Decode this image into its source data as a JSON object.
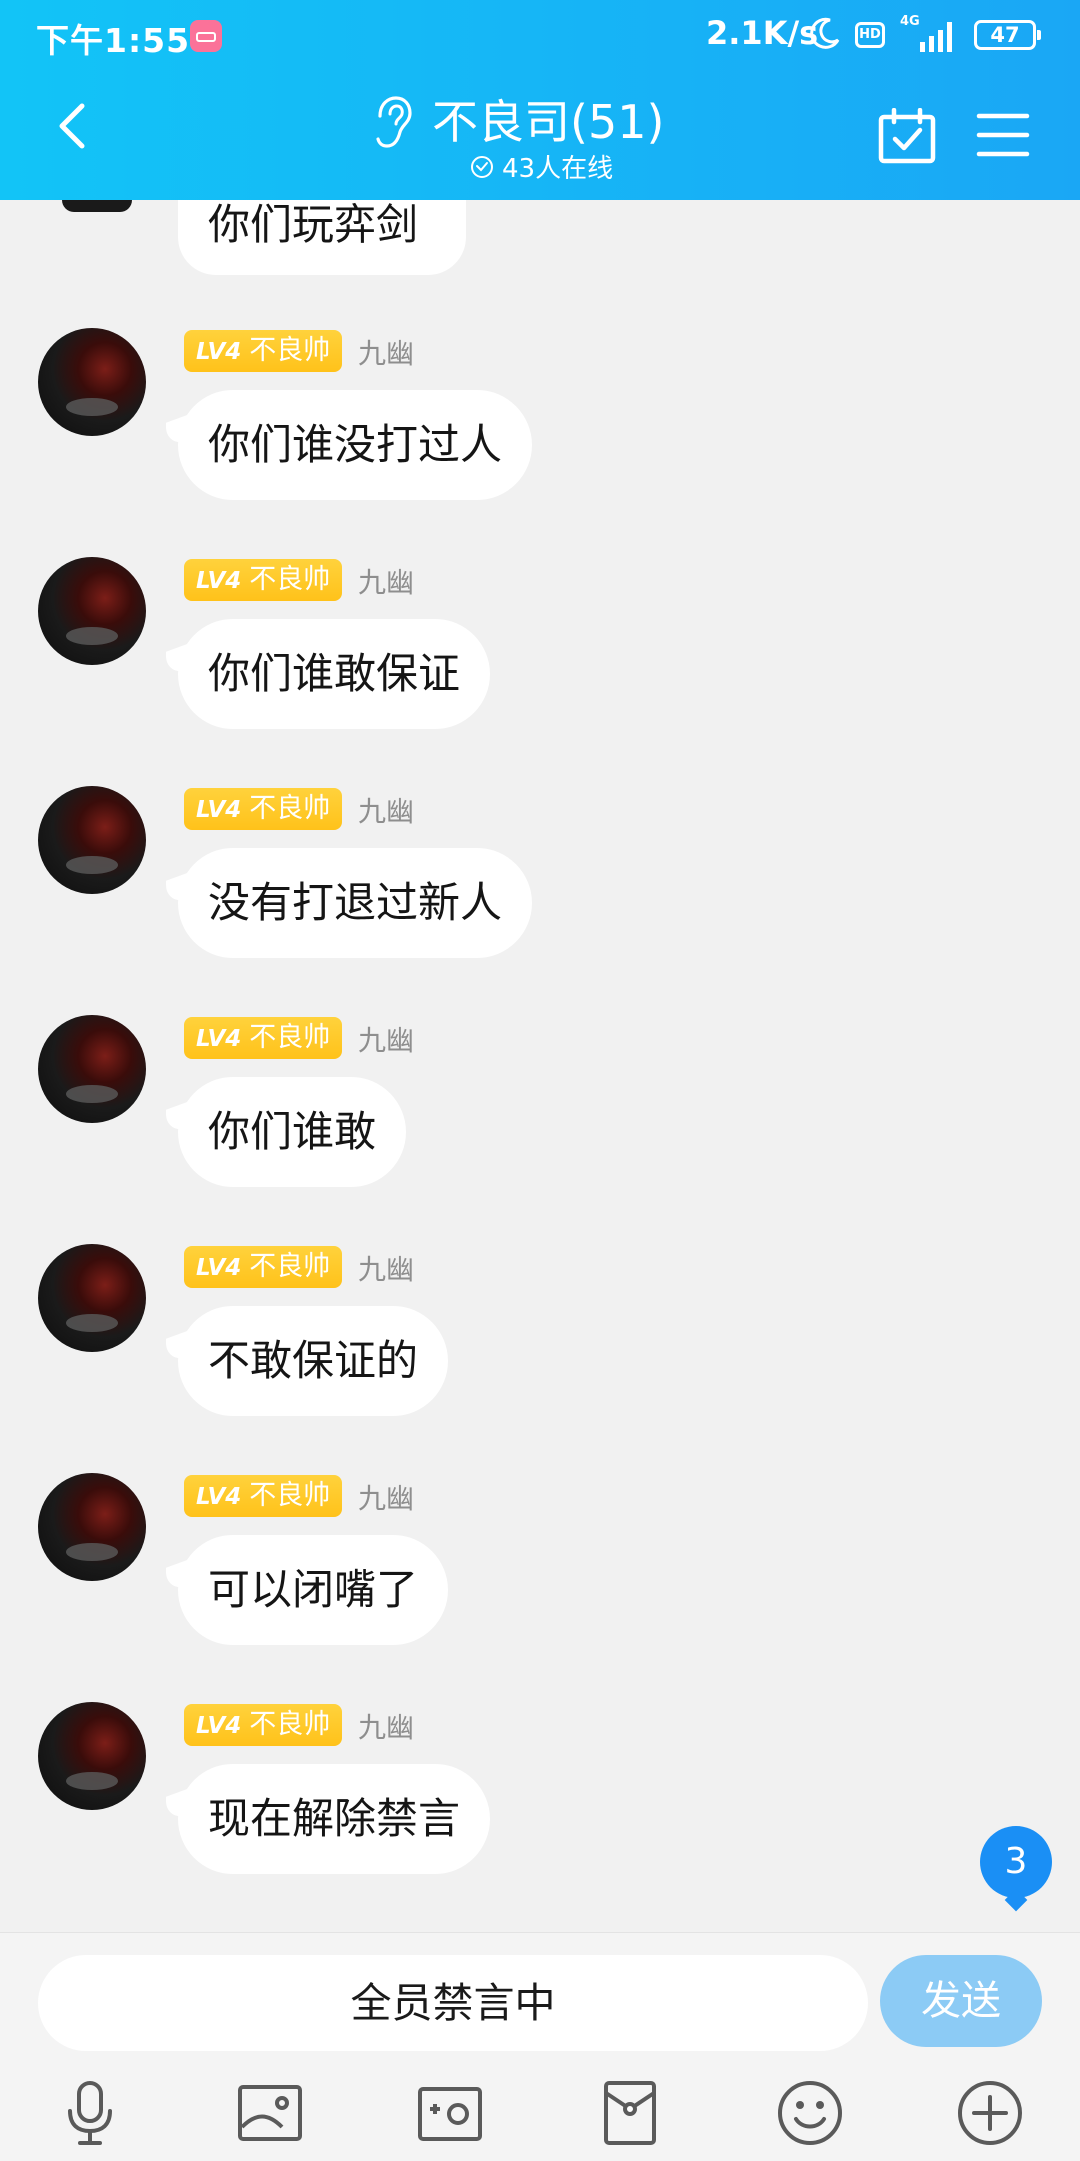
{
  "status_bar": {
    "time": "下午1:55",
    "speed": "2.1K/s",
    "hd": "HD",
    "network": "4G",
    "battery": "47"
  },
  "header": {
    "title": "不良司(51)",
    "online": "43人在线"
  },
  "top_partial_message": "你们玩弈剑",
  "messages": [
    {
      "badge_level": "LV4",
      "badge_title": "不良帅",
      "sender": "九幽",
      "text": "你们谁没打过人"
    },
    {
      "badge_level": "LV4",
      "badge_title": "不良帅",
      "sender": "九幽",
      "text": "你们谁敢保证"
    },
    {
      "badge_level": "LV4",
      "badge_title": "不良帅",
      "sender": "九幽",
      "text": "没有打退过新人"
    },
    {
      "badge_level": "LV4",
      "badge_title": "不良帅",
      "sender": "九幽",
      "text": "你们谁敢"
    },
    {
      "badge_level": "LV4",
      "badge_title": "不良帅",
      "sender": "九幽",
      "text": "不敢保证的"
    },
    {
      "badge_level": "LV4",
      "badge_title": "不良帅",
      "sender": "九幽",
      "text": "可以闭嘴了"
    },
    {
      "badge_level": "LV4",
      "badge_title": "不良帅",
      "sender": "九幽",
      "text": "现在解除禁言"
    }
  ],
  "unread_count": "3",
  "input": {
    "muted_text": "全员禁言中",
    "send_label": "发送"
  },
  "toolbar_icons": [
    "microphone-icon",
    "image-icon",
    "camera-icon",
    "red-packet-icon",
    "emoji-icon",
    "plus-icon"
  ],
  "colors": {
    "header_start": "#12c4f7",
    "header_end": "#1aa7f5",
    "badge": "#ffc21a",
    "send_button": "#8ccbf5",
    "unread": "#1a8ff5"
  }
}
